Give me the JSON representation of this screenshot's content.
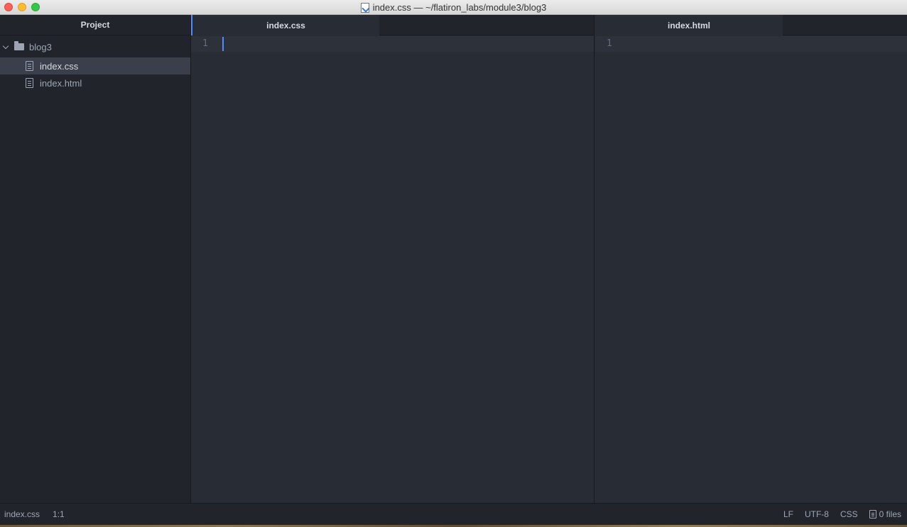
{
  "window": {
    "title": "index.css — ~/flatiron_labs/module3/blog3"
  },
  "sidebar": {
    "header": "Project",
    "root": "blog3",
    "items": [
      {
        "label": "index.css",
        "selected": true
      },
      {
        "label": "index.html",
        "selected": false
      }
    ]
  },
  "editor_left": {
    "tab_label": "index.css",
    "line_number": "1"
  },
  "editor_right": {
    "tab_label": "index.html",
    "line_number": "1"
  },
  "statusbar": {
    "file": "index.css",
    "cursor_position": "1:1",
    "line_ending": "LF",
    "encoding": "UTF-8",
    "grammar": "CSS",
    "files_count": "0 files"
  },
  "colors": {
    "accent": "#528bff",
    "sidebar_bg": "#21252b",
    "editor_bg": "#282c34"
  }
}
